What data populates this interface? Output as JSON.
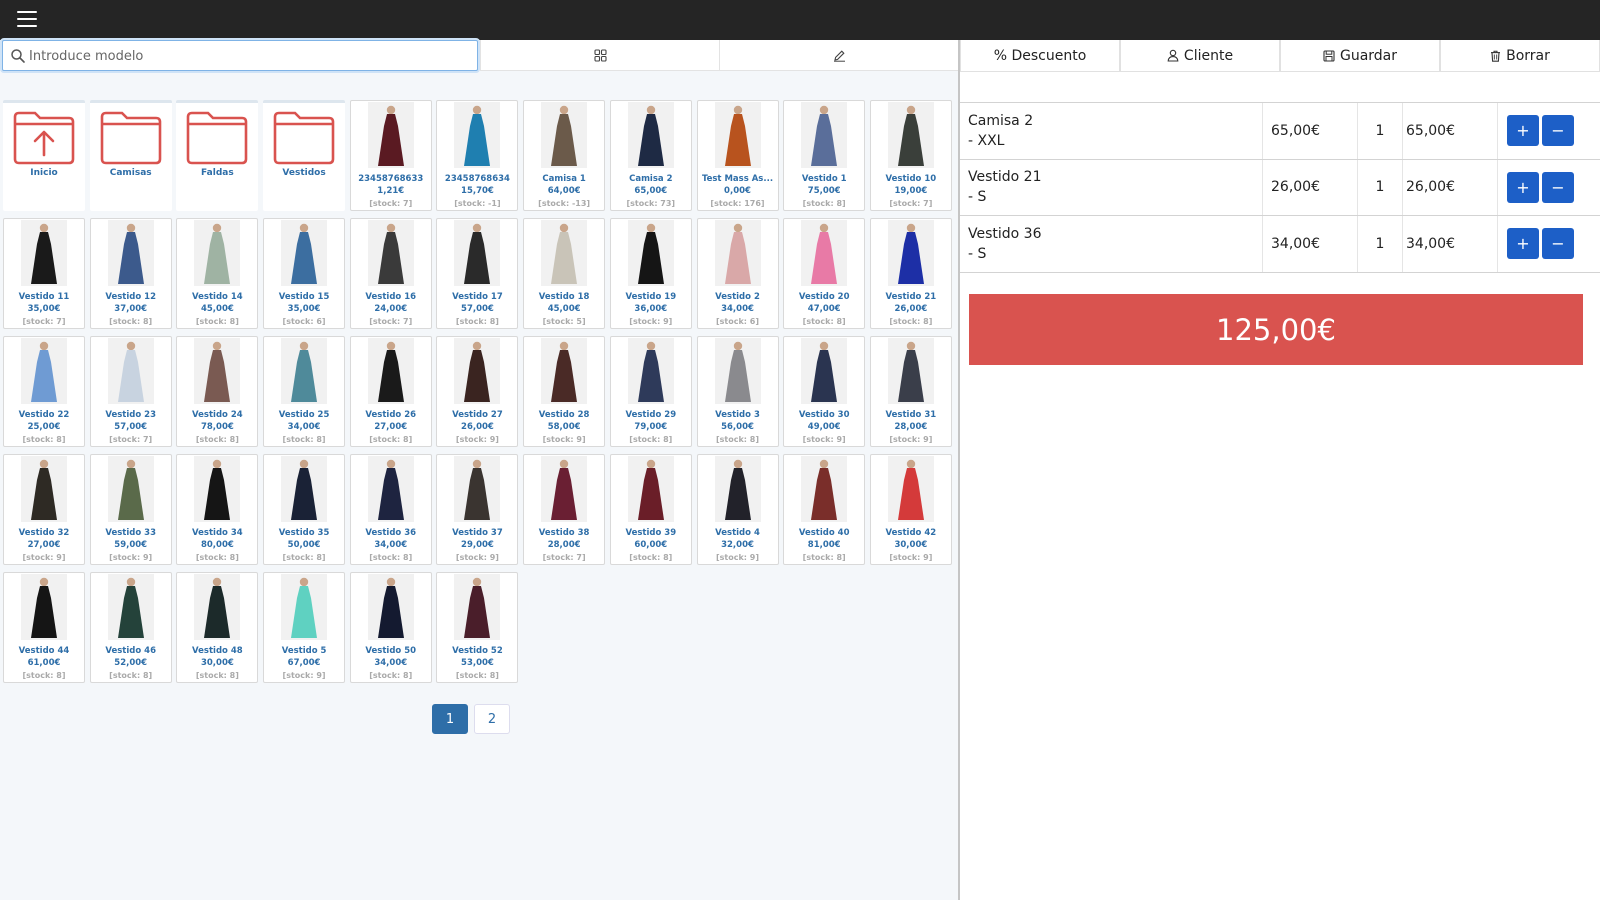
{
  "search": {
    "placeholder": "Introduce modelo",
    "value": ""
  },
  "toolbar": {
    "discount_label": "% Descuento",
    "customer_label": "Cliente",
    "save_label": "Guardar",
    "delete_label": "Borrar"
  },
  "folders": [
    {
      "label": "Inicio",
      "icon": "folder-up-icon"
    },
    {
      "label": "Camisas",
      "icon": "folder-icon"
    },
    {
      "label": "Faldas",
      "icon": "folder-icon"
    },
    {
      "label": "Vestidos",
      "icon": "folder-icon"
    }
  ],
  "products": [
    {
      "name": "23458768633",
      "price": "1,21€",
      "stock": "[stock: 7]",
      "color": "#5a1a22"
    },
    {
      "name": "23458768634",
      "price": "15,70€",
      "stock": "[stock: -1]",
      "color": "#1f7fb0"
    },
    {
      "name": "Camisa 1",
      "price": "64,00€",
      "stock": "[stock: -13]",
      "color": "#6b5a4a"
    },
    {
      "name": "Camisa 2",
      "price": "65,00€",
      "stock": "[stock: 73]",
      "color": "#1e2a44"
    },
    {
      "name": "Test Mass As...",
      "price": "0,00€",
      "stock": "[stock: 176]",
      "color": "#b8531e"
    },
    {
      "name": "Vestido 1",
      "price": "75,00€",
      "stock": "[stock: 8]",
      "color": "#5a6e9a"
    },
    {
      "name": "Vestido 10",
      "price": "19,00€",
      "stock": "[stock: 7]",
      "color": "#3a3f3a"
    },
    {
      "name": "Vestido 11",
      "price": "35,00€",
      "stock": "[stock: 7]",
      "color": "#1a1a1a"
    },
    {
      "name": "Vestido 12",
      "price": "37,00€",
      "stock": "[stock: 8]",
      "color": "#3c5a8c"
    },
    {
      "name": "Vestido 14",
      "price": "45,00€",
      "stock": "[stock: 8]",
      "color": "#9fb3a3"
    },
    {
      "name": "Vestido 15",
      "price": "35,00€",
      "stock": "[stock: 6]",
      "color": "#3c6ea0"
    },
    {
      "name": "Vestido 16",
      "price": "24,00€",
      "stock": "[stock: 7]",
      "color": "#3a3a3a"
    },
    {
      "name": "Vestido 17",
      "price": "57,00€",
      "stock": "[stock: 8]",
      "color": "#2a2a2a"
    },
    {
      "name": "Vestido 18",
      "price": "45,00€",
      "stock": "[stock: 5]",
      "color": "#c9c4b8"
    },
    {
      "name": "Vestido 19",
      "price": "36,00€",
      "stock": "[stock: 9]",
      "color": "#151515"
    },
    {
      "name": "Vestido 2",
      "price": "34,00€",
      "stock": "[stock: 6]",
      "color": "#d9a8a8"
    },
    {
      "name": "Vestido 20",
      "price": "47,00€",
      "stock": "[stock: 8]",
      "color": "#e87aa6"
    },
    {
      "name": "Vestido 21",
      "price": "26,00€",
      "stock": "[stock: 8]",
      "color": "#1d2fa6"
    },
    {
      "name": "Vestido 22",
      "price": "25,00€",
      "stock": "[stock: 8]",
      "color": "#6f9bd3"
    },
    {
      "name": "Vestido 23",
      "price": "57,00€",
      "stock": "[stock: 7]",
      "color": "#c8d3e0"
    },
    {
      "name": "Vestido 24",
      "price": "78,00€",
      "stock": "[stock: 8]",
      "color": "#7a5a52"
    },
    {
      "name": "Vestido 25",
      "price": "34,00€",
      "stock": "[stock: 8]",
      "color": "#4f8a9a"
    },
    {
      "name": "Vestido 26",
      "price": "27,00€",
      "stock": "[stock: 8]",
      "color": "#1a1a1a"
    },
    {
      "name": "Vestido 27",
      "price": "26,00€",
      "stock": "[stock: 9]",
      "color": "#3a2420"
    },
    {
      "name": "Vestido 28",
      "price": "58,00€",
      "stock": "[stock: 9]",
      "color": "#4a2a26"
    },
    {
      "name": "Vestido 29",
      "price": "79,00€",
      "stock": "[stock: 8]",
      "color": "#2e3a5a"
    },
    {
      "name": "Vestido 3",
      "price": "56,00€",
      "stock": "[stock: 8]",
      "color": "#8a8a8e"
    },
    {
      "name": "Vestido 30",
      "price": "49,00€",
      "stock": "[stock: 9]",
      "color": "#2a3450"
    },
    {
      "name": "Vestido 31",
      "price": "28,00€",
      "stock": "[stock: 9]",
      "color": "#3a3e4a"
    },
    {
      "name": "Vestido 32",
      "price": "27,00€",
      "stock": "[stock: 9]",
      "color": "#2e2a24"
    },
    {
      "name": "Vestido 33",
      "price": "59,00€",
      "stock": "[stock: 9]",
      "color": "#5a6a4a"
    },
    {
      "name": "Vestido 34",
      "price": "80,00€",
      "stock": "[stock: 8]",
      "color": "#151515"
    },
    {
      "name": "Vestido 35",
      "price": "50,00€",
      "stock": "[stock: 8]",
      "color": "#1a2236"
    },
    {
      "name": "Vestido 36",
      "price": "34,00€",
      "stock": "[stock: 8]",
      "color": "#1e2440"
    },
    {
      "name": "Vestido 37",
      "price": "29,00€",
      "stock": "[stock: 9]",
      "color": "#3a3430"
    },
    {
      "name": "Vestido 38",
      "price": "28,00€",
      "stock": "[stock: 7]",
      "color": "#6a1f33"
    },
    {
      "name": "Vestido 39",
      "price": "60,00€",
      "stock": "[stock: 8]",
      "color": "#6a1e28"
    },
    {
      "name": "Vestido 4",
      "price": "32,00€",
      "stock": "[stock: 9]",
      "color": "#22222a"
    },
    {
      "name": "Vestido 40",
      "price": "81,00€",
      "stock": "[stock: 8]",
      "color": "#7a2e2a"
    },
    {
      "name": "Vestido 42",
      "price": "30,00€",
      "stock": "[stock: 9]",
      "color": "#d43a3a"
    },
    {
      "name": "Vestido 44",
      "price": "61,00€",
      "stock": "[stock: 8]",
      "color": "#151515"
    },
    {
      "name": "Vestido 46",
      "price": "52,00€",
      "stock": "[stock: 8]",
      "color": "#24423a"
    },
    {
      "name": "Vestido 48",
      "price": "30,00€",
      "stock": "[stock: 8]",
      "color": "#1c2a2a"
    },
    {
      "name": "Vestido 5",
      "price": "67,00€",
      "stock": "[stock: 9]",
      "color": "#5fd1c1"
    },
    {
      "name": "Vestido 50",
      "price": "34,00€",
      "stock": "[stock: 8]",
      "color": "#141a30"
    },
    {
      "name": "Vestido 52",
      "price": "53,00€",
      "stock": "[stock: 8]",
      "color": "#4a1e2a"
    }
  ],
  "pagination": {
    "pages": [
      "1",
      "2"
    ],
    "active": "1"
  },
  "ticket": {
    "lines": [
      {
        "name": "Camisa 2",
        "variant": "- XXL",
        "price": "65,00€",
        "qty": "1",
        "total": "65,00€"
      },
      {
        "name": "Vestido 21",
        "variant": "- S",
        "price": "26,00€",
        "qty": "1",
        "total": "26,00€"
      },
      {
        "name": "Vestido 36",
        "variant": "- S",
        "price": "34,00€",
        "qty": "1",
        "total": "34,00€"
      }
    ],
    "total": "125,00€"
  },
  "colors": {
    "accent": "#2e6ea8",
    "folder": "#d9534f",
    "action": "#1d5fc7",
    "total_bg": "#d9534f",
    "topbar": "#252525"
  }
}
